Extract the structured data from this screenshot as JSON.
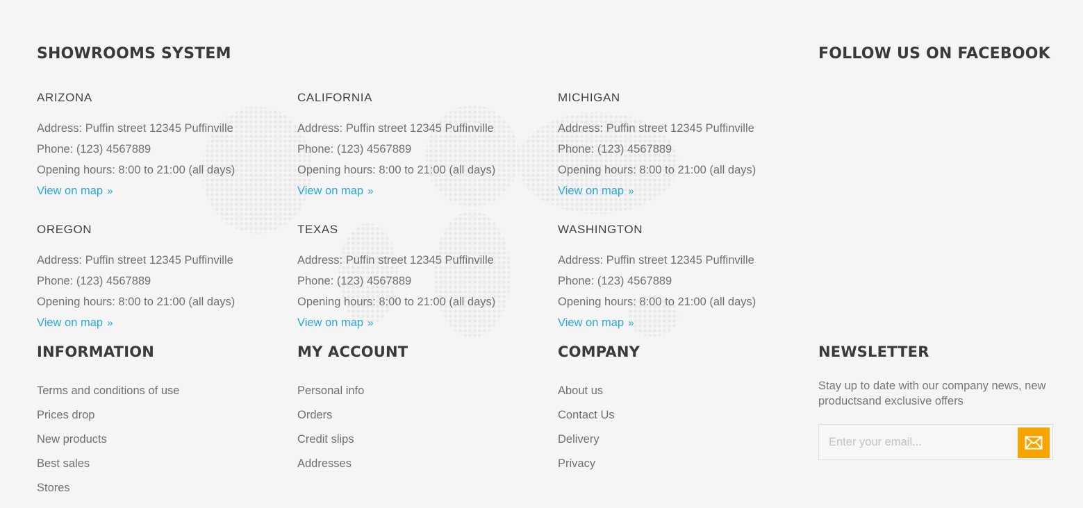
{
  "showrooms": {
    "title": "SHOWROOMS SYSTEM",
    "items": [
      {
        "state": "ARIZONA",
        "address": "Address: Puffin street 12345 Puffinville",
        "phone": "Phone: (123) 4567889",
        "hours": "Opening hours: 8:00 to 21:00 (all days)",
        "link": "View on map"
      },
      {
        "state": "CALIFORNIA",
        "address": "Address: Puffin street 12345 Puffinville",
        "phone": "Phone: (123) 4567889",
        "hours": "Opening hours: 8:00 to 21:00 (all days)",
        "link": "View on map"
      },
      {
        "state": "MICHIGAN",
        "address": "Address: Puffin street 12345 Puffinville",
        "phone": "Phone: (123) 4567889",
        "hours": "Opening hours: 8:00 to 21:00 (all days)",
        "link": "View on map"
      },
      {
        "state": "OREGON",
        "address": "Address: Puffin street 12345 Puffinville",
        "phone": "Phone: (123) 4567889",
        "hours": "Opening hours: 8:00 to 21:00 (all days)",
        "link": "View on map"
      },
      {
        "state": "TEXAS",
        "address": "Address: Puffin street 12345 Puffinville",
        "phone": "Phone: (123) 4567889",
        "hours": "Opening hours: 8:00 to 21:00 (all days)",
        "link": "View on map"
      },
      {
        "state": "WASHINGTON",
        "address": "Address: Puffin street 12345 Puffinville",
        "phone": "Phone: (123) 4567889",
        "hours": "Opening hours: 8:00 to 21:00 (all days)",
        "link": "View on map"
      }
    ]
  },
  "facebook": {
    "title": "FOLLOW US ON FACEBOOK"
  },
  "information": {
    "title": "INFORMATION",
    "links": [
      "Terms and conditions of use",
      "Prices drop",
      "New products",
      "Best sales",
      "Stores"
    ]
  },
  "my_account": {
    "title": "MY ACCOUNT",
    "links": [
      "Personal info",
      "Orders",
      "Credit slips",
      "Addresses"
    ]
  },
  "company": {
    "title": "COMPANY",
    "links": [
      "About us",
      "Contact Us",
      "Delivery",
      "Privacy"
    ]
  },
  "newsletter": {
    "title": "NEWSLETTER",
    "text": "Stay up to date with our company news, new productsand exclusive offers",
    "placeholder": "Enter your email...",
    "button_icon": "envelope-icon"
  },
  "colors": {
    "link": "#2aa8d8",
    "accent": "#f5a400",
    "background": "#f5f5f5"
  }
}
